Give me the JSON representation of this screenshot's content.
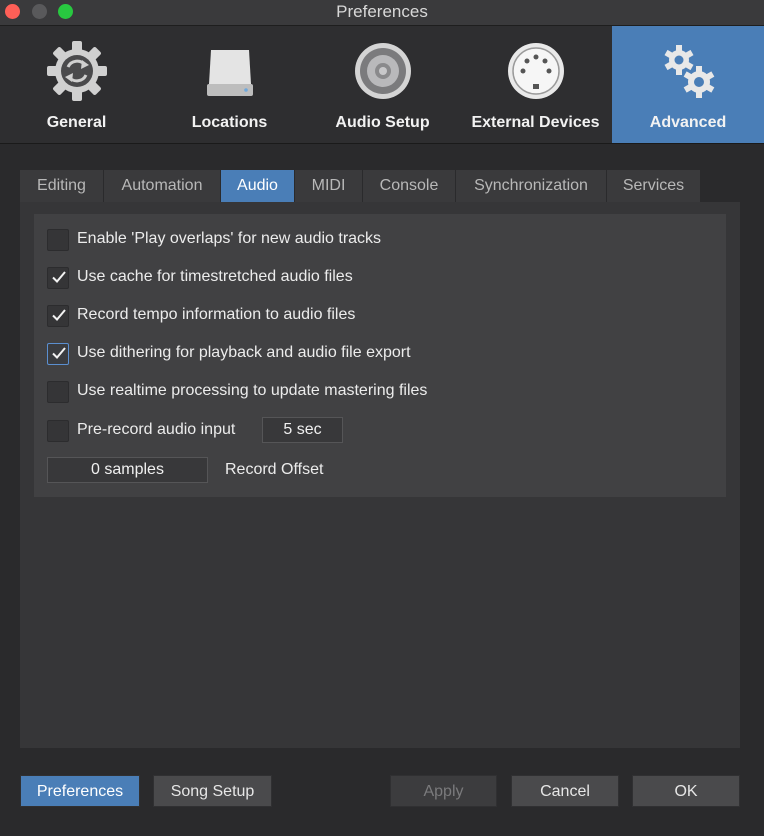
{
  "window": {
    "title": "Preferences"
  },
  "toolbar": {
    "items": [
      {
        "label": "General",
        "icon": "gear-sync-icon"
      },
      {
        "label": "Locations",
        "icon": "drive-icon"
      },
      {
        "label": "Audio Setup",
        "icon": "speaker-icon"
      },
      {
        "label": "External Devices",
        "icon": "midi-port-icon"
      },
      {
        "label": "Advanced",
        "icon": "gears-icon"
      }
    ],
    "active": "Advanced"
  },
  "tabs": {
    "items": [
      "Editing",
      "Automation",
      "Audio",
      "MIDI",
      "Console",
      "Synchronization",
      "Services"
    ],
    "active": "Audio"
  },
  "audio": {
    "options": [
      {
        "label": "Enable 'Play overlaps' for new audio tracks",
        "checked": false
      },
      {
        "label": "Use cache for timestretched audio files",
        "checked": true
      },
      {
        "label": "Record tempo information to audio files",
        "checked": true
      },
      {
        "label": "Use dithering for playback and audio file export",
        "checked": true
      },
      {
        "label": "Use realtime processing to update mastering files",
        "checked": false
      },
      {
        "label": "Pre-record audio input",
        "checked": false
      }
    ],
    "prerecord_value": "5 sec",
    "record_offset_value": "0 samples",
    "record_offset_label": "Record Offset"
  },
  "footer": {
    "preferences_label": "Preferences",
    "song_setup_label": "Song Setup",
    "apply_label": "Apply",
    "cancel_label": "Cancel",
    "ok_label": "OK"
  },
  "colors": {
    "accent": "#4a7eb7",
    "background": "#2a2a2c"
  }
}
